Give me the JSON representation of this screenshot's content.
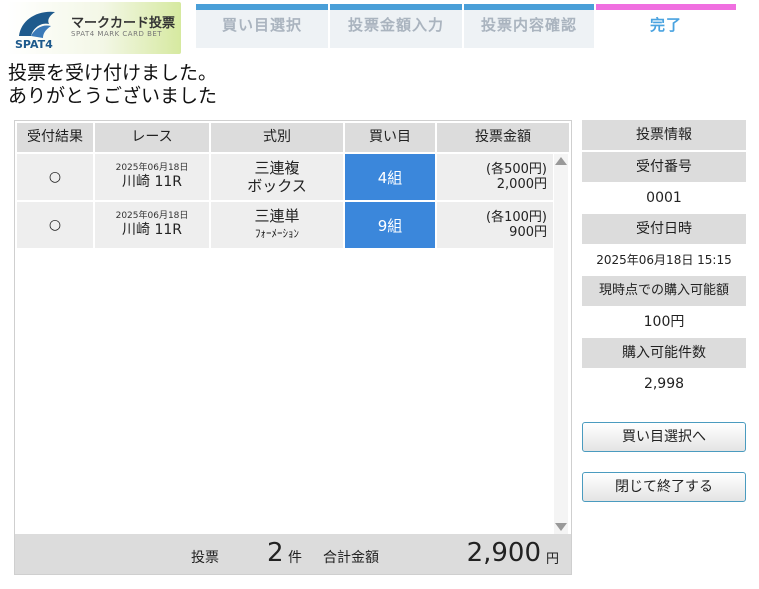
{
  "logo": {
    "title": "マークカード投票",
    "subtitle": "SPAT4 MARK CARD BET",
    "mark_text": "SPAT4",
    "colors": {
      "mark": "#1e5a8c",
      "accent": "#9ccc3c"
    }
  },
  "steps": [
    {
      "label": "買い目選択",
      "bar_color": "#4a9fd8",
      "active": false
    },
    {
      "label": "投票金額入力",
      "bar_color": "#4a9fd8",
      "active": false
    },
    {
      "label": "投票内容確認",
      "bar_color": "#4a9fd8",
      "active": false
    },
    {
      "label": "完了",
      "bar_color": "#f06fe0",
      "active": true
    }
  ],
  "message": {
    "line1": "投票を受け付けました。",
    "line2": "ありがとうございました"
  },
  "table": {
    "headers": [
      "受付結果",
      "レース",
      "式別",
      "買い目",
      "投票金額"
    ],
    "rows": [
      {
        "result": "○",
        "race_date": "2025年06月18日",
        "race_name": "川崎 11R",
        "type_line1": "三連複",
        "type_line2": "ボックス",
        "kumi": "4組",
        "amount_each": "(各500円)",
        "amount_total": "2,000円"
      },
      {
        "result": "○",
        "race_date": "2025年06月18日",
        "race_name": "川崎 11R",
        "type_line1": "三連単",
        "type_line2": "ﾌｫｰﾒｰｼｮﾝ",
        "kumi": "9組",
        "amount_each": "(各100円)",
        "amount_total": "900円"
      }
    ],
    "footer": {
      "vote_label": "投票",
      "count": "2",
      "count_unit": "件",
      "total_label": "合計金額",
      "total": "2,900",
      "total_unit": "円"
    }
  },
  "panel": {
    "title": "投票情報",
    "receipt_label": "受付番号",
    "receipt_value": "0001",
    "datetime_label": "受付日時",
    "datetime_value": "2025年06月18日 15:15",
    "purchasable_label": "現時点での購入可能額",
    "purchasable_value": "100円",
    "count_label": "購入可能件数",
    "count_value": "2,998"
  },
  "buttons": {
    "back": "買い目選択へ",
    "close": "閉じて終了する"
  }
}
